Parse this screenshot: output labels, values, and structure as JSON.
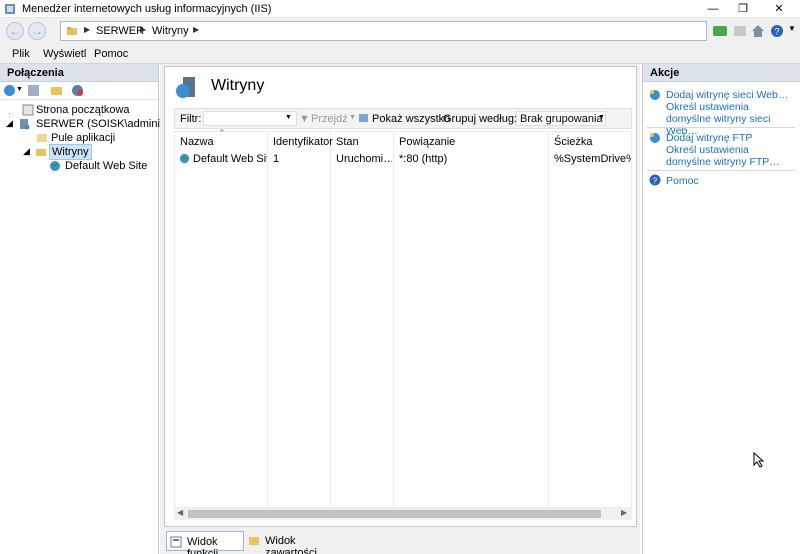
{
  "window": {
    "title": "Menedżer internetowych usług informacyjnych (IIS)",
    "controls": [
      "minimize",
      "restore",
      "close"
    ]
  },
  "address": {
    "crumbs": [
      "SERWER",
      "Witryny"
    ]
  },
  "menu": {
    "items": [
      "Plik",
      "Wyświetl",
      "Pomoc"
    ]
  },
  "connections": {
    "title": "Połączenia",
    "tree": [
      {
        "label": "Strona początkowa"
      },
      {
        "label": "SERWER (SOISK\\administrator"
      },
      {
        "label": "Pule aplikacji"
      },
      {
        "label": "Witryny"
      },
      {
        "label": "Default Web Site"
      }
    ]
  },
  "main": {
    "title": "Witryny",
    "filter_label": "Filtr:",
    "go_label": "Przejdź",
    "show_all_label": "Pokaż wszystko",
    "group_by_label": "Grupuj według:",
    "group_value": "Brak grupowania",
    "columns": [
      "Nazwa",
      "Identyfikator",
      "Stan",
      "Powiązanie",
      "Ścieżka"
    ],
    "rows": [
      {
        "name": "Default Web Site",
        "id": "1",
        "state": "Uruchomi…",
        "binding": "*:80 (http)",
        "path": "%SystemDrive%\\in"
      }
    ],
    "tabs": {
      "features": "Widok funkcji",
      "content": "Widok zawartości"
    }
  },
  "actions": {
    "title": "Akcje",
    "add_site": "Dodaj witrynę sieci Web…",
    "site_defaults": "Określ ustawienia domyślne witryny sieci Web…",
    "add_ftp": "Dodaj witrynę FTP",
    "ftp_defaults": "Określ ustawienia domyślne witryny FTP…",
    "help": "Pomoc"
  },
  "colors": {
    "link": "#1c70c3",
    "panel_header": "#dde3ea",
    "selection": "#cce4f7"
  }
}
